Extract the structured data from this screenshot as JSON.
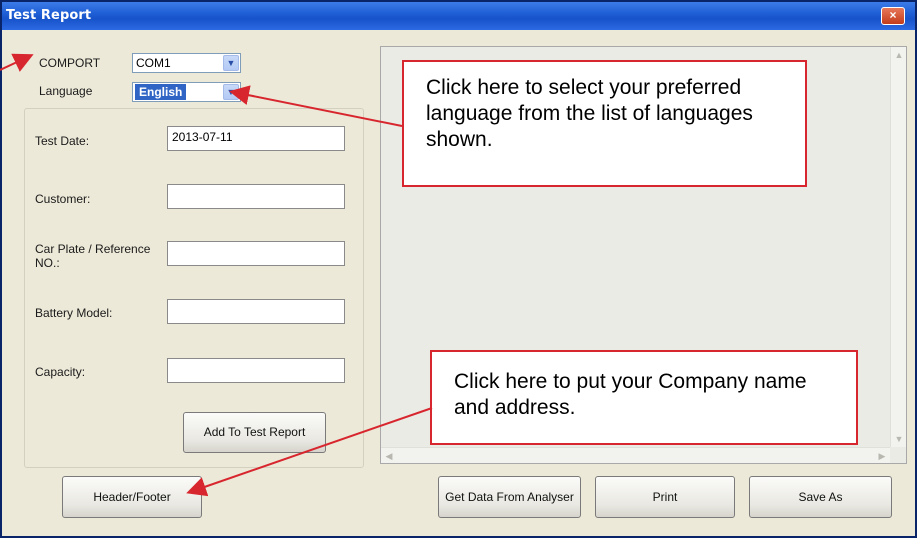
{
  "window": {
    "title": "Test Report",
    "close_glyph": "×"
  },
  "settings": {
    "comport_label": "COMPORT",
    "comport_value": "COM1",
    "language_label": "Language",
    "language_value": "English"
  },
  "form": {
    "test_date_label": "Test Date:",
    "test_date_value": "2013-07-11",
    "customer_label": "Customer:",
    "customer_value": "",
    "car_plate_label": "Car Plate / Reference NO.:",
    "car_plate_value": "",
    "battery_model_label": "Battery Model:",
    "battery_model_value": "",
    "capacity_label": "Capacity:",
    "capacity_value": "",
    "add_button": "Add To Test Report"
  },
  "buttons": {
    "header_footer": "Header/Footer",
    "get_data": "Get Data From Analyser",
    "print": "Print",
    "save_as": "Save As"
  },
  "callouts": {
    "language_help": "Click here to select your preferred language from the list of languages shown.",
    "company_help": "Click here to put your Company name and address."
  },
  "icons": {
    "dropdown": "chevron-down-icon",
    "scroll_up": "scroll-up-icon",
    "scroll_down": "scroll-down-icon",
    "scroll_left": "scroll-left-icon",
    "scroll_right": "scroll-right-icon"
  },
  "colors": {
    "titlebar": "#2c6ae3",
    "window_bg": "#ece9d8",
    "callout_border": "#d8262e",
    "selection": "#3165c5"
  }
}
